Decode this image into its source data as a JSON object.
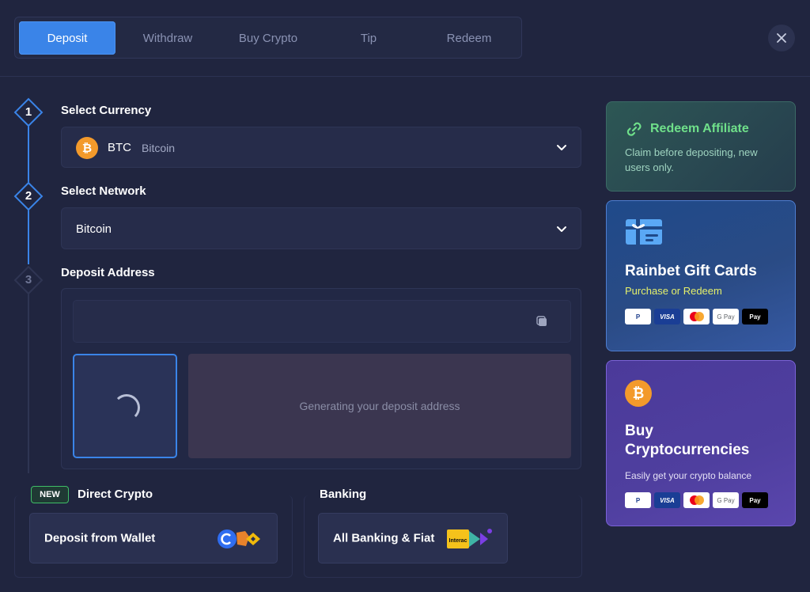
{
  "tabs": [
    "Deposit",
    "Withdraw",
    "Buy Crypto",
    "Tip",
    "Redeem"
  ],
  "active_tab": "Deposit",
  "steps": [
    {
      "number": "1",
      "title": "Select Currency"
    },
    {
      "number": "2",
      "title": "Select Network"
    },
    {
      "number": "3",
      "title": "Deposit Address"
    }
  ],
  "currency": {
    "code": "BTC",
    "name": "Bitcoin",
    "icon": "bitcoin-icon",
    "color": "#f39a2b",
    "coin_glyph": "₿"
  },
  "network": {
    "value": "Bitcoin"
  },
  "deposit_address": {
    "status_text": "Generating your deposit address"
  },
  "direct_crypto": {
    "badge": "NEW",
    "title": "Direct Crypto",
    "button": "Deposit from Wallet"
  },
  "banking": {
    "title": "Banking",
    "button": "All Banking & Fiat",
    "interac_text": "Interac"
  },
  "affiliate_card": {
    "title": "Redeem Affiliate",
    "subtitle": "Claim before depositing, new users only."
  },
  "gift_card": {
    "title": "Rainbet Gift Cards",
    "subtitle": "Purchase or Redeem"
  },
  "buy_card": {
    "title_line1": "Buy",
    "title_line2": "Cryptocurrencies",
    "subtitle": "Easily get your crypto balance",
    "coin_glyph": "₿"
  },
  "payment_methods": [
    "P",
    "VISA",
    "",
    "G Pay",
    "Pay"
  ],
  "colors": {
    "accent": "#3a84e8",
    "affiliate_green": "#6fe08a",
    "gift_yellow": "#e5f06a"
  }
}
